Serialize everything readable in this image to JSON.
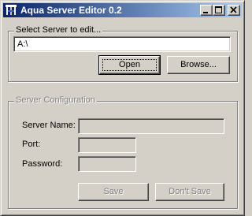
{
  "window": {
    "title": "Aqua Server Editor 0.2",
    "controls": {
      "minimize": "minimize",
      "maximize": "maximize",
      "close": "close"
    }
  },
  "select_group": {
    "legend": "Select Server to edit...",
    "path_value": "A:\\",
    "open_label": "Open",
    "browse_label": "Browse..."
  },
  "config_group": {
    "legend": "Server Configuration",
    "server_name_label": "Server Name:",
    "port_label": "Port:",
    "password_label": "Password:",
    "server_name_value": "",
    "port_value": "",
    "password_value": "",
    "save_label": "Save",
    "dont_save_label": "Don't Save"
  },
  "colors": {
    "titlebar_start": "#0a246a",
    "titlebar_end": "#a6caf0",
    "face": "#d4d0c8",
    "disabled_text": "#808080"
  }
}
